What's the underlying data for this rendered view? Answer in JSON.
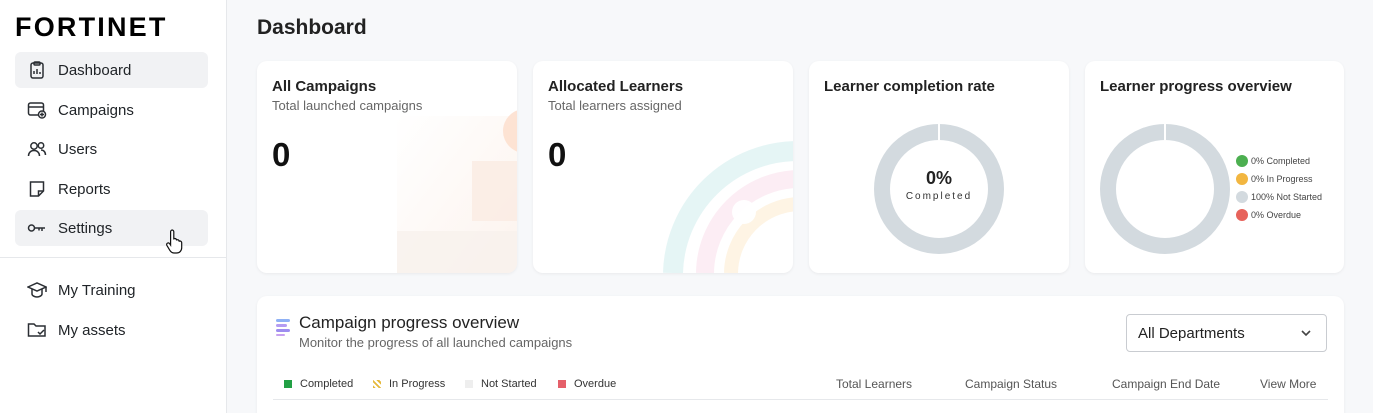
{
  "brand": {
    "name": "FORTINET"
  },
  "sidebar": {
    "items": [
      {
        "label": "Dashboard",
        "icon": "dashboard-icon",
        "active": true
      },
      {
        "label": "Campaigns",
        "icon": "campaigns-icon"
      },
      {
        "label": "Users",
        "icon": "users-icon"
      },
      {
        "label": "Reports",
        "icon": "reports-icon"
      },
      {
        "label": "Settings",
        "icon": "key-icon",
        "hovered": true
      }
    ],
    "secondary": [
      {
        "label": "My Training",
        "icon": "graduation-cap-icon"
      },
      {
        "label": "My assets",
        "icon": "folder-icon"
      }
    ]
  },
  "page": {
    "title": "Dashboard"
  },
  "cards": {
    "campaigns": {
      "title": "All Campaigns",
      "subtitle": "Total launched campaigns",
      "value": "0"
    },
    "learners": {
      "title": "Allocated Learners",
      "subtitle": "Total learners assigned",
      "value": "0"
    },
    "completion": {
      "title": "Learner completion rate",
      "percent": "0%",
      "sub": "Completed"
    },
    "progress": {
      "title": "Learner progress overview",
      "legend": [
        {
          "label": "0% Completed",
          "color": "#4caf50"
        },
        {
          "label": "0% In Progress",
          "color": "#f2b640"
        },
        {
          "label": "100% Not Started",
          "color": "#d3dadf"
        },
        {
          "label": "0% Overdue",
          "color": "#e7635b"
        }
      ]
    }
  },
  "campaign_overview": {
    "title": "Campaign progress overview",
    "subtitle": "Monitor the progress of all launched campaigns",
    "department_select": "All Departments",
    "legend": [
      {
        "label": "Completed",
        "color": "#22a045"
      },
      {
        "label": "In Progress",
        "color": "#e5b93c"
      },
      {
        "label": "Not Started",
        "color": "#eeeeee"
      },
      {
        "label": "Overdue",
        "color": "#e5606a"
      }
    ],
    "columns": [
      "Total Learners",
      "Campaign Status",
      "Campaign End Date",
      "View More"
    ]
  },
  "colors": {
    "donut_track": "#d3dadf",
    "accent": "#7c6cf0"
  }
}
